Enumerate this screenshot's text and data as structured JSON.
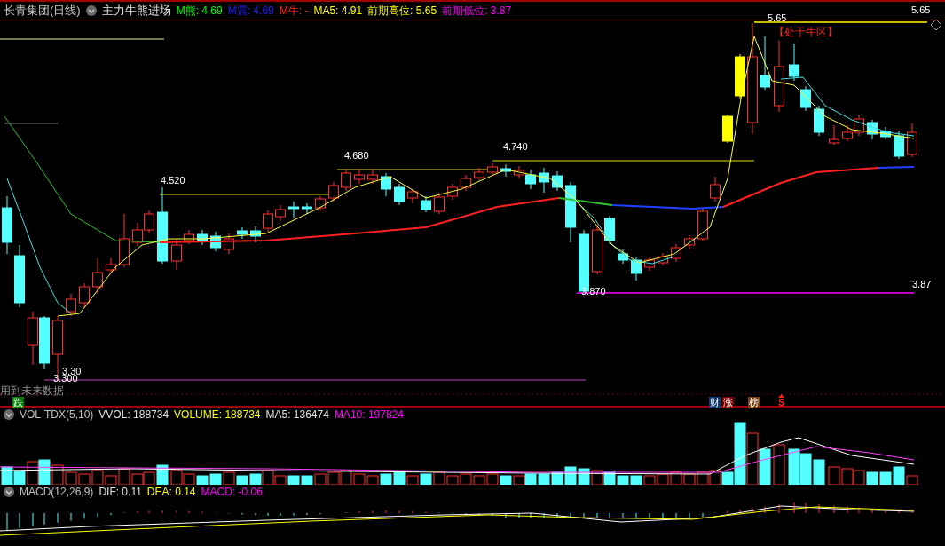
{
  "header": {
    "title": "长青集团(日线)",
    "indicator": "主力牛熊进场",
    "values": [
      {
        "text": "M熊: 4.69",
        "kind": "green"
      },
      {
        "text": "M震: 4.69",
        "kind": "blue"
      },
      {
        "text": "M牛: -",
        "kind": "red"
      },
      {
        "text": "MA5: 4.91",
        "kind": "yellow"
      },
      {
        "text": "前期高位: 5.65",
        "kind": "yellow"
      },
      {
        "text": "前期低位: 3.87",
        "kind": "magenta"
      }
    ]
  },
  "main_chart": {
    "price_labels": [
      "4.520",
      "4.680",
      "4.740",
      "3.870",
      "3.87",
      "5.65",
      "5.65",
      "3.30",
      "3.300"
    ],
    "zone_label": "【处于牛区】",
    "warning": "用到未来数据",
    "signals": [
      {
        "kind": "badge",
        "text": "跌",
        "color": "#008000"
      },
      {
        "kind": "badge",
        "text": "财",
        "color": "#103a70"
      },
      {
        "kind": "badge",
        "text": "涨",
        "color": "#800000"
      },
      {
        "kind": "badge",
        "text": "榜",
        "color": "#7a4010"
      },
      {
        "kind": "arrow",
        "text": "S"
      }
    ]
  },
  "volume": {
    "title": "VOL-TDX(5,10)",
    "values": [
      {
        "text": "VVOL: 188734",
        "kind": "white"
      },
      {
        "text": "VOLUME: 188734",
        "kind": "yellow"
      },
      {
        "text": "MA5: 136474",
        "kind": "white"
      },
      {
        "text": "MA10: 197824",
        "kind": "magenta"
      }
    ]
  },
  "macd": {
    "title": "MACD(12,26,9)",
    "values": [
      {
        "text": "DIF: 0.11",
        "kind": "white"
      },
      {
        "text": "DEA: 0.14",
        "kind": "yellow"
      },
      {
        "text": "MACD: -0.06",
        "kind": "magenta"
      }
    ]
  }
}
